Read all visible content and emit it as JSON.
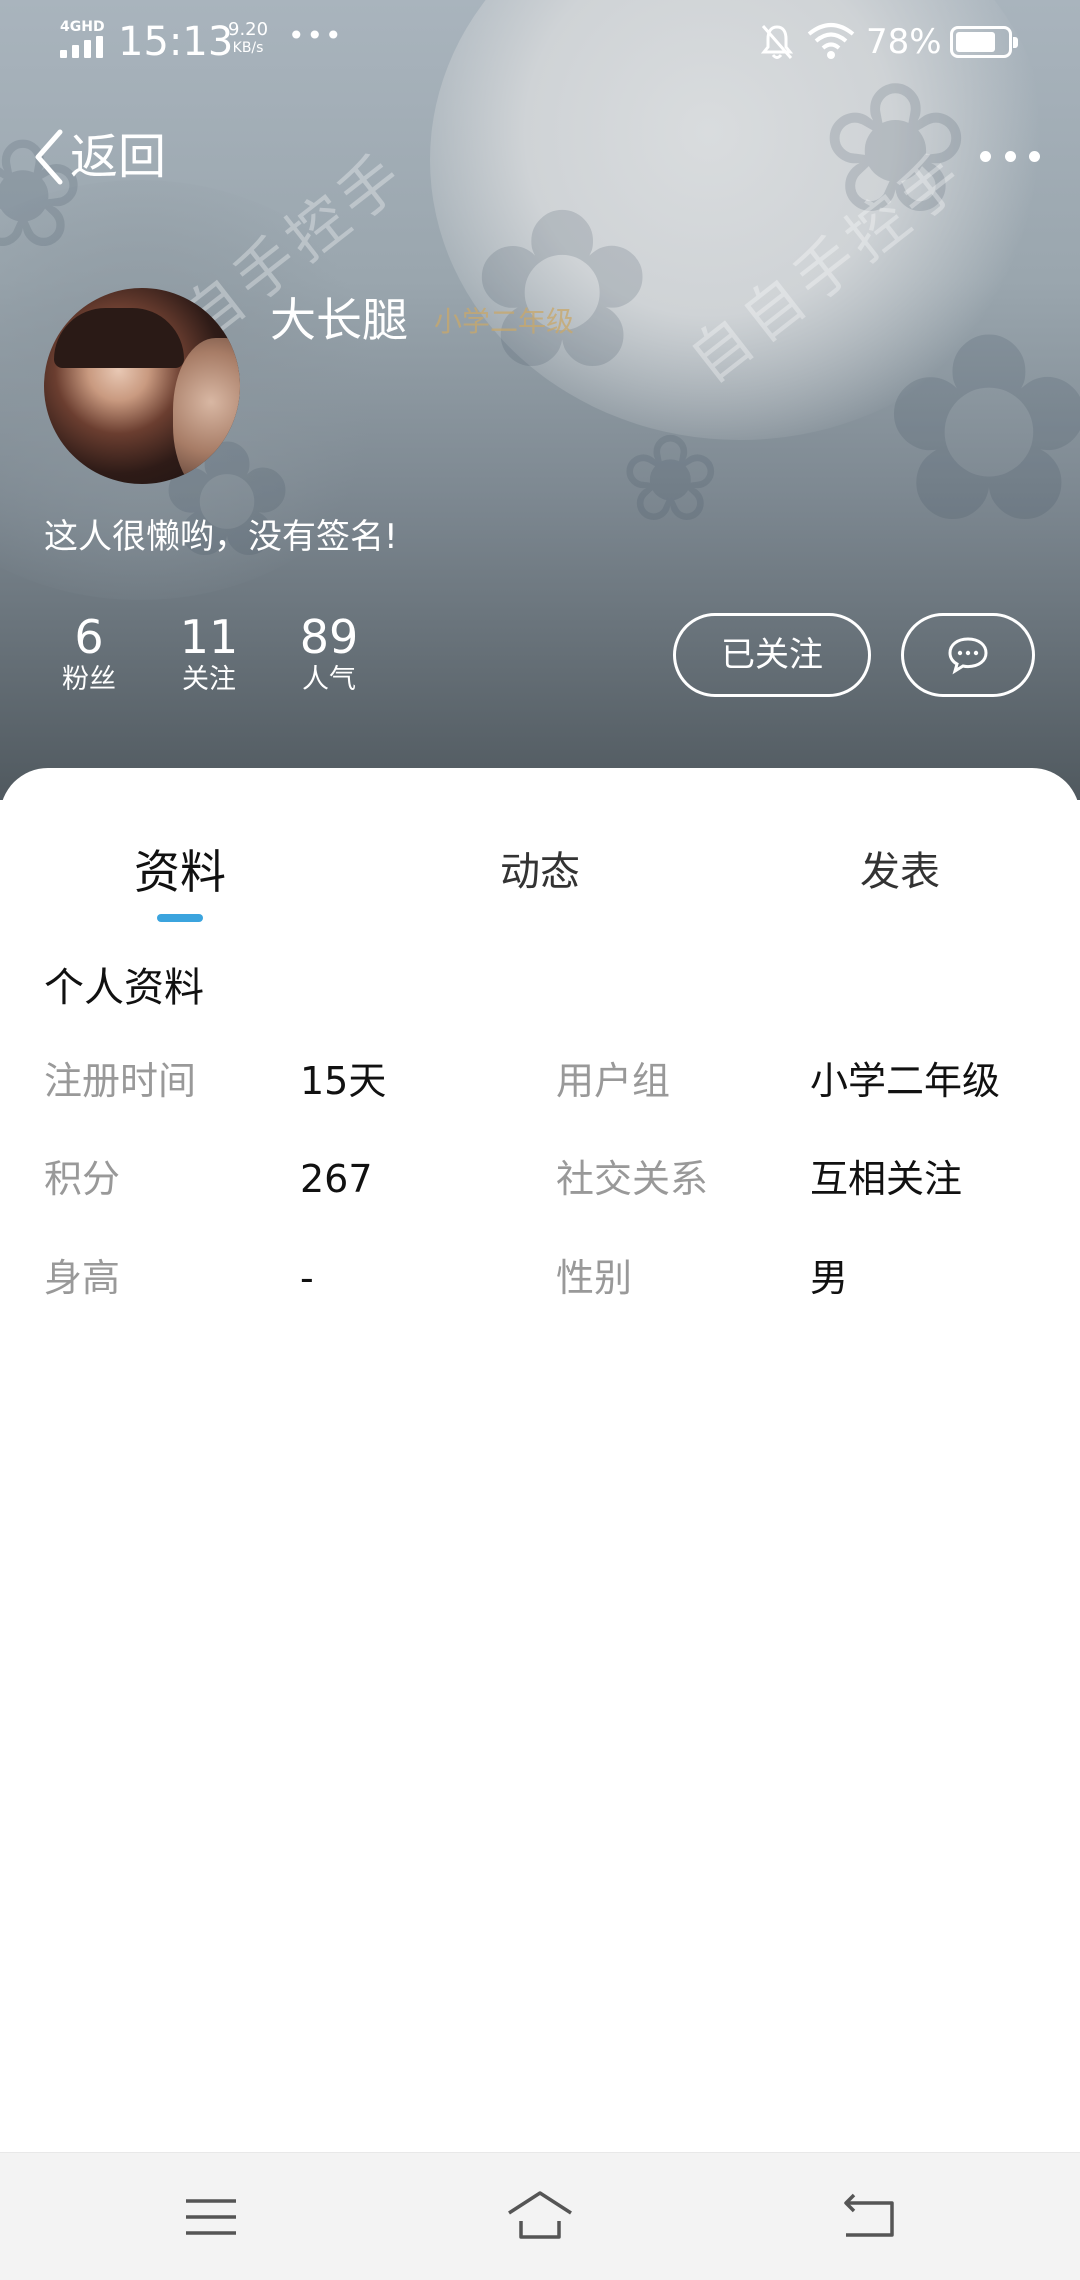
{
  "status": {
    "network": "4GHD",
    "time": "15:13",
    "speed_value": "9.20",
    "speed_unit": "KB/s",
    "more_dots": "•••",
    "battery_pct": "78%",
    "battery_level": 0.78
  },
  "nav": {
    "back_label": "返回"
  },
  "profile": {
    "name": "大长腿",
    "level": "小学二年级",
    "signature": "这人很懒哟，没有签名!",
    "stats": [
      {
        "value": "6",
        "label": "粉丝"
      },
      {
        "value": "11",
        "label": "关注"
      },
      {
        "value": "89",
        "label": "人气"
      }
    ],
    "follow_button": "已关注",
    "watermark": "自自手控手"
  },
  "tabs": [
    {
      "label": "资料",
      "active": true
    },
    {
      "label": "动态",
      "active": false
    },
    {
      "label": "发表",
      "active": false
    }
  ],
  "info": {
    "section_title": "个人资料",
    "rows": [
      {
        "k1": "注册时间",
        "v1": "15天",
        "k2": "用户组",
        "v2": "小学二年级"
      },
      {
        "k1": "积分",
        "v1": "267",
        "k2": "社交关系",
        "v2": "互相关注"
      },
      {
        "k1": "身高",
        "v1": "-",
        "k2": "性别",
        "v2": "男"
      }
    ]
  },
  "colors": {
    "accent": "#3ba4de",
    "level": "#c9a86a"
  },
  "icons": {
    "back": "chevron-left-icon",
    "more": "more-dots-icon",
    "message": "chat-bubble-icon",
    "menu": "menu-icon",
    "home": "home-icon",
    "back_nav": "back-arrow-icon"
  }
}
